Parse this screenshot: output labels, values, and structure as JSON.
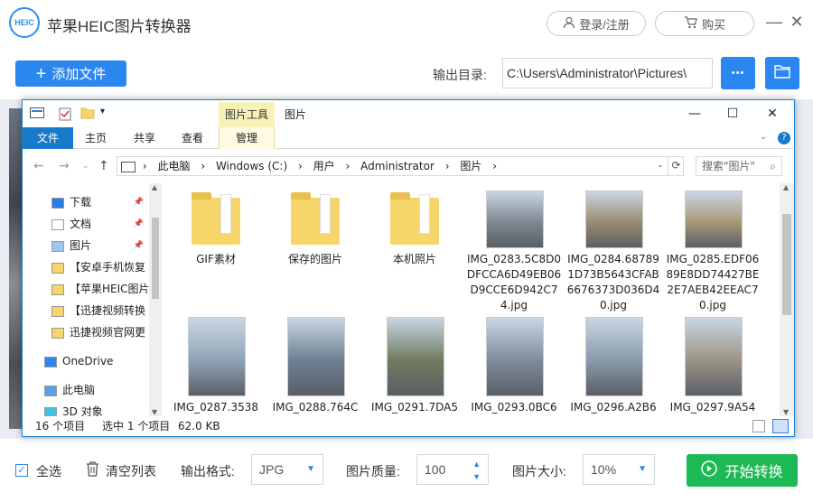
{
  "app": {
    "title": "苹果HEIC图片转换器",
    "logo_text": "HEIC",
    "login_label": "登录/注册",
    "buy_label": "购买",
    "minimize": "—",
    "close": "✕"
  },
  "toolbar": {
    "add_label": "添加文件",
    "output_label": "输出目录:",
    "output_path": "C:\\Users\\Administrator\\Pictures\\",
    "more": "•••"
  },
  "explorer": {
    "context_tab": "图片工具",
    "caption": "图片",
    "tabs": [
      "文件",
      "主页",
      "共享",
      "查看",
      "管理"
    ],
    "path": [
      "此电脑",
      "Windows (C:)",
      "用户",
      "Administrator",
      "图片"
    ],
    "search_placeholder": "搜索\"图片\"",
    "nav": [
      {
        "label": "下载",
        "pinned": true,
        "icon": "download-icon"
      },
      {
        "label": "文档",
        "pinned": true,
        "icon": "document-icon"
      },
      {
        "label": "图片",
        "pinned": true,
        "icon": "pictures-icon"
      },
      {
        "label": "【安卓手机恢复",
        "pinned": false,
        "icon": "folder-icon"
      },
      {
        "label": "【苹果HEIC图片",
        "pinned": false,
        "icon": "folder-icon"
      },
      {
        "label": "【迅捷视频转换",
        "pinned": false,
        "icon": "folder-icon"
      },
      {
        "label": "迅捷视频官网更",
        "pinned": false,
        "icon": "folder-icon"
      },
      {
        "label": "OneDrive",
        "pinned": false,
        "icon": "cloud-icon"
      },
      {
        "label": "此电脑",
        "pinned": false,
        "icon": "computer-icon"
      },
      {
        "label": "3D 对象",
        "pinned": false,
        "icon": "cube-icon"
      }
    ],
    "items": [
      {
        "name": "GIF素材",
        "kind": "folder"
      },
      {
        "name": "保存的图片",
        "kind": "folder"
      },
      {
        "name": "本机照片",
        "kind": "folder"
      },
      {
        "name": "IMG_0283.5C8D0DFCCA6D49EB06D9CCE6D942C74.jpg",
        "kind": "photo",
        "color": "#7e8790"
      },
      {
        "name": "IMG_0284.687891D73B5643CFAB6676373D036D40.jpg",
        "kind": "photo",
        "color": "#9a8b70"
      },
      {
        "name": "IMG_0285.EDF0689E8DD74427BE2E7AEB42EEAC70.jpg",
        "kind": "photo",
        "color": "#a89878"
      },
      {
        "name": "IMG_0287.3538",
        "kind": "photo",
        "color": "#8fa3b6"
      },
      {
        "name": "IMG_0288.764C",
        "kind": "photo",
        "color": "#6e7f92"
      },
      {
        "name": "IMG_0291.7DA5",
        "kind": "photo",
        "color": "#6f7a5e"
      },
      {
        "name": "IMG_0293.0BC6",
        "kind": "photo",
        "color": "#7d8b9b"
      },
      {
        "name": "IMG_0296.A2B6",
        "kind": "photo",
        "color": "#8899aa"
      },
      {
        "name": "IMG_0297.9A54",
        "kind": "photo",
        "color": "#9b9486"
      }
    ],
    "status_count": "16 个项目",
    "status_selected": "选中 1 个项目",
    "status_size": "62.0 KB"
  },
  "bottom": {
    "select_all": "全选",
    "clear_list": "清空列表",
    "format_label": "输出格式:",
    "format_value": "JPG",
    "quality_label": "图片质量:",
    "quality_value": "100",
    "size_label": "图片大小:",
    "size_value": "10%",
    "start_label": "开始转换"
  }
}
